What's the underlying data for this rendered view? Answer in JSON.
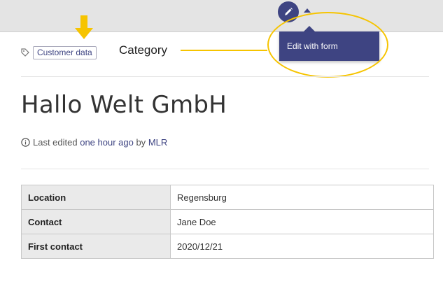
{
  "toolbar": {
    "edit_icon": "pencil-icon",
    "menu_icon": "caret-up-icon",
    "accent_color": "#3e4482",
    "popup_label": "Edit with form"
  },
  "annotation": {
    "category_label": "Category",
    "highlight_color": "#f6c400"
  },
  "page": {
    "category_tag": "Customer data",
    "title": "Hallo Welt GmbH",
    "meta": {
      "prefix": "Last edited ",
      "time_link": "one hour ago",
      "by": " by ",
      "author_link": "MLR"
    }
  },
  "infobox": {
    "rows": [
      {
        "key": "Location",
        "value": "Regensburg"
      },
      {
        "key": "Contact",
        "value": "Jane Doe"
      },
      {
        "key": "First contact",
        "value": "2020/12/21"
      }
    ]
  }
}
